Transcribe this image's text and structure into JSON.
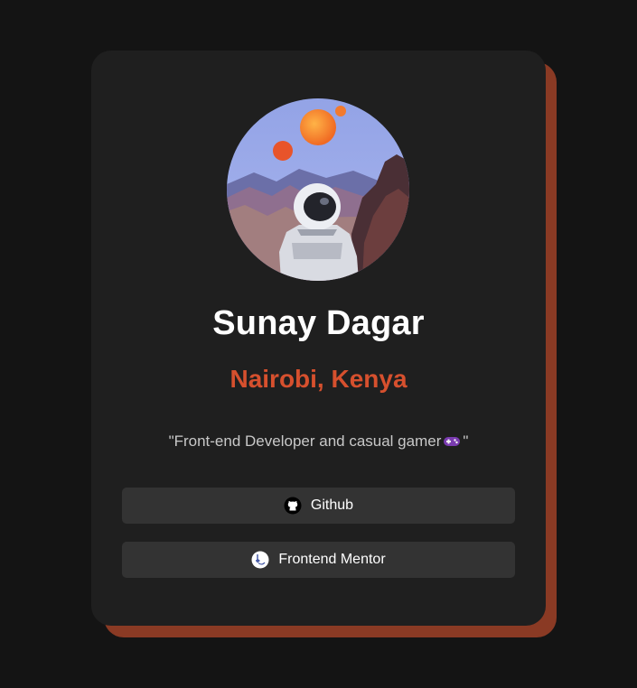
{
  "profile": {
    "name": "Sunay Dagar",
    "location": "Nairobi, Kenya",
    "bio_open": "\"Front-end Developer and casual gamer",
    "bio_close": "\"",
    "bio_emoji": "gamepad-icon"
  },
  "links": [
    {
      "label": "Github",
      "icon": "github-icon"
    },
    {
      "label": "Frontend Mentor",
      "icon": "frontend-mentor-icon"
    }
  ],
  "colors": {
    "page_bg": "#141414",
    "card_bg": "#1f1f1f",
    "card_shadow": "#8a3a24",
    "accent": "#d6502e",
    "button_bg": "#333333"
  }
}
